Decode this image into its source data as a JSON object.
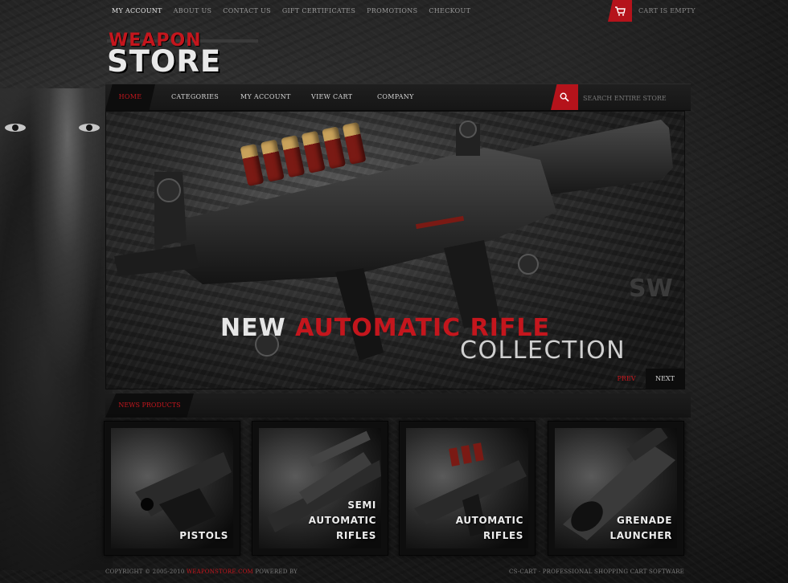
{
  "top_links": [
    "My Account",
    "About Us",
    "Contact Us",
    "Gift Certificates",
    "Promotions",
    "Checkout"
  ],
  "cart": {
    "label": "Cart is empty",
    "icon": "cart-icon"
  },
  "logo": {
    "line1": "WEAPON",
    "line2": "STORE"
  },
  "nav": {
    "items": [
      "Home",
      "Categories",
      "My Account",
      "View Cart",
      "Company"
    ],
    "search_placeholder": "Search entire store",
    "search_icon": "search-icon"
  },
  "slider": {
    "headline_white": "NEW",
    "headline_red": "AUTOMATIC RIFLE",
    "subline": "COLLECTION",
    "prev": "Prev",
    "next": "Next"
  },
  "new_products": {
    "title": "News products",
    "items": [
      {
        "line1": "",
        "line2": "",
        "line3": "PISTOLS"
      },
      {
        "line1": "SEMI",
        "line2": "AUTOMATIC",
        "line3": "RIFLES"
      },
      {
        "line1": "",
        "line2": "AUTOMATIC",
        "line3": "RIFLES"
      },
      {
        "line1": "",
        "line2": "GRENADE",
        "line3": "LAUNCHER"
      }
    ]
  },
  "footer": {
    "copyright": "Copyright © 2005-2010",
    "site": "weaponstore.com",
    "powered": "Powered by",
    "right": "CS-Cart · Professional shopping cart software"
  },
  "colors": {
    "accent": "#c4161d",
    "background": "#1a1a1a",
    "text": "#d6d6d6"
  }
}
